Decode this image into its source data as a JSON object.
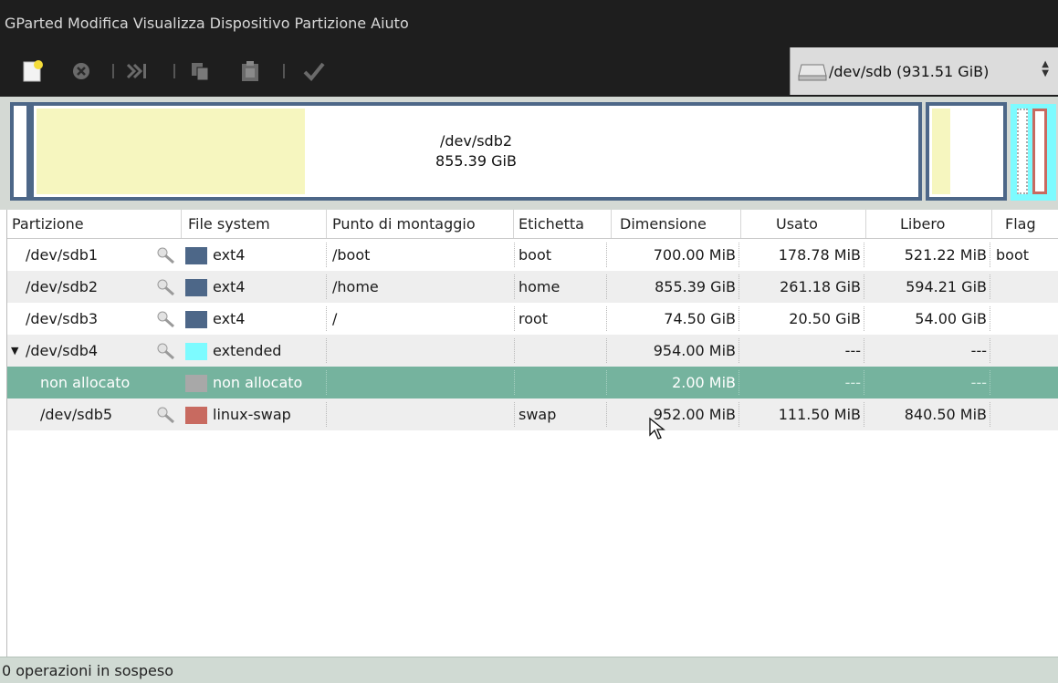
{
  "menubar": {
    "items": [
      "GParted",
      "Modifica",
      "Visualizza",
      "Dispositivo",
      "Partizione",
      "Aiuto"
    ]
  },
  "toolbar": {
    "icons": [
      "new-icon",
      "delete-icon",
      "resize-move-icon",
      "copy-icon",
      "paste-icon",
      "apply-icon"
    ]
  },
  "device_selector": {
    "label": "/dev/sdb  (931.51 GiB)"
  },
  "disk_map": {
    "selected_label": "/dev/sdb2",
    "selected_size": "855.39 GiB",
    "colors": {
      "ext4": "#4d6788",
      "used": "#f6f6bf",
      "extended": "#7dfbff",
      "swap": "#c86a60"
    }
  },
  "table": {
    "columns": [
      "Partizione",
      "File system",
      "Punto di montaggio",
      "Etichetta",
      "Dimensione",
      "Usato",
      "Libero",
      "Flag"
    ],
    "rows": [
      {
        "partition": "/dev/sdb1",
        "fs": "ext4",
        "fs_color": "#4d6788",
        "mount": "/boot",
        "label": "boot",
        "size": "700.00 MiB",
        "used": "178.78 MiB",
        "free": "521.22 MiB",
        "flag": "boot"
      },
      {
        "partition": "/dev/sdb2",
        "fs": "ext4",
        "fs_color": "#4d6788",
        "mount": "/home",
        "label": "home",
        "size": "855.39 GiB",
        "used": "261.18 GiB",
        "free": "594.21 GiB",
        "flag": ""
      },
      {
        "partition": "/dev/sdb3",
        "fs": "ext4",
        "fs_color": "#4d6788",
        "mount": "/",
        "label": "root",
        "size": "74.50 GiB",
        "used": "20.50 GiB",
        "free": "54.00 GiB",
        "flag": ""
      },
      {
        "partition": "/dev/sdb4",
        "fs": "extended",
        "fs_color": "#7dfbff",
        "mount": "",
        "label": "",
        "size": "954.00 MiB",
        "used": "---",
        "free": "---",
        "flag": ""
      },
      {
        "partition": "non allocato",
        "fs": "non allocato",
        "fs_color": "#a8a8a8",
        "mount": "",
        "label": "",
        "size": "2.00 MiB",
        "used": "---",
        "free": "---",
        "flag": ""
      },
      {
        "partition": "/dev/sdb5",
        "fs": "linux-swap",
        "fs_color": "#c86a60",
        "mount": "",
        "label": "swap",
        "size": "952.00 MiB",
        "used": "111.50 MiB",
        "free": "840.50 MiB",
        "flag": ""
      }
    ],
    "selected_row_color": "#75b39e"
  },
  "statusbar": {
    "text": "0 operazioni in sospeso"
  }
}
